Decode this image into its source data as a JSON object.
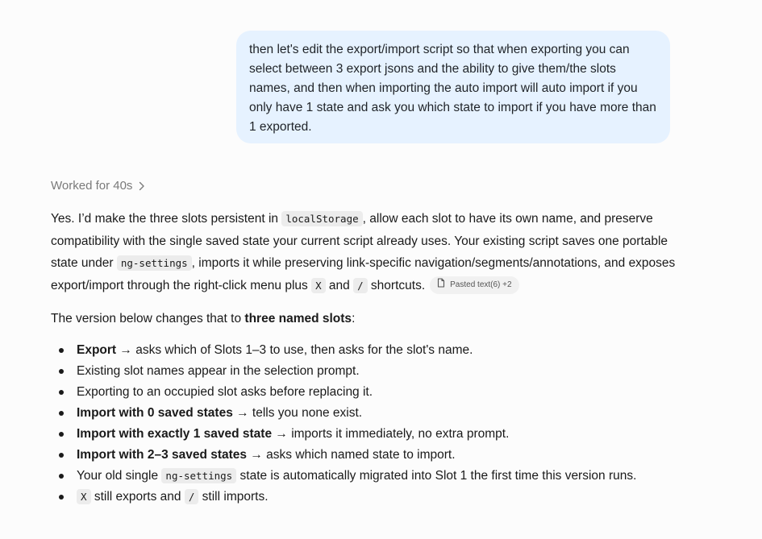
{
  "user_message": {
    "text": "then let's edit the export/import script so that when exporting you can select between 3 export jsons and the ability to give them/the slots names, and then when importing  the auto import will auto import if you only have 1 state and ask you which state to import if you have more than 1 exported."
  },
  "worked": {
    "label": "Worked for 40s",
    "icon": "chevron-right-icon"
  },
  "response": {
    "p1": {
      "t1": "Yes. I’d make the three slots persistent in ",
      "c1": "localStorage",
      "t2": ", allow each slot to have its own name, and preserve compatibility with the single saved state your current script already uses. Your existing script saves one portable state under ",
      "c2": "ng-settings",
      "t3": ", imports it while preserving link-specific navigation/segments/annotations, and exposes export/import through the right-click menu plus ",
      "c3": "X",
      "t4": " and ",
      "c4": "/",
      "t5": " shortcuts.",
      "attachment": {
        "label": "Pasted text(6) +2",
        "icon": "document-icon"
      }
    },
    "p2": {
      "t1": "The version below changes that to ",
      "b1": "three named slots",
      "t2": ":"
    },
    "bullets": [
      {
        "bold": "Export",
        "text": " → asks which of Slots 1–3 to use, then asks for the slot's name."
      },
      {
        "text": "Existing slot names appear in the selection prompt."
      },
      {
        "text": "Exporting to an occupied slot asks before replacing it."
      },
      {
        "bold": "Import with 0 saved states",
        "text": " → tells you none exist."
      },
      {
        "bold": "Import with exactly 1 saved state",
        "text": " → imports it immediately, no extra prompt."
      },
      {
        "bold": "Import with 2–3 saved states",
        "text": " → asks which named state to import."
      },
      {
        "pre": "Your old single ",
        "code": "ng-settings",
        "text": " state is automatically migrated into Slot 1 the first time this version runs."
      },
      {
        "code": "X",
        "text": " still exports and ",
        "code2": "/",
        "text2": " still imports."
      }
    ]
  }
}
